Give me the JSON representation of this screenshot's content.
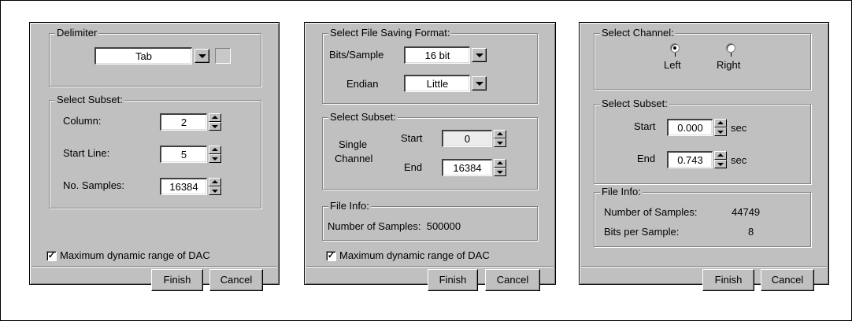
{
  "panel1": {
    "delimiter_title": "Delimiter",
    "delimiter_value": "Tab",
    "subset_title": "Select Subset:",
    "column_label": "Column:",
    "column_value": "2",
    "start_line_label": "Start Line:",
    "start_line_value": "5",
    "samples_label": "No. Samples:",
    "samples_value": "16384",
    "max_dac_label": "Maximum dynamic range of DAC",
    "max_dac_checked": true,
    "finish_label": "Finish",
    "cancel_label": "Cancel"
  },
  "panel2": {
    "format_title": "Select File Saving Format:",
    "bits_label": "Bits/Sample",
    "bits_value": "16 bit",
    "endian_label": "Endian",
    "endian_value": "Little",
    "subset_title": "Select Subset:",
    "single_label": "Single",
    "channel_label": "Channel",
    "start_label": "Start",
    "start_value": "0",
    "end_label": "End",
    "end_value": "16384",
    "fileinfo_title": "File Info:",
    "num_samples_text": "Number of Samples:  500000",
    "max_dac_label": "Maximum dynamic range of DAC",
    "max_dac_checked": true,
    "finish_label": "Finish",
    "cancel_label": "Cancel"
  },
  "panel3": {
    "channel_title": "Select Channel:",
    "left_label": "Left",
    "right_label": "Right",
    "selected_channel": "Left",
    "subset_title": "Select Subset:",
    "start_label": "Start",
    "start_value": "0.000",
    "start_unit": "sec",
    "end_label": "End",
    "end_value": "0.743",
    "end_unit": "sec",
    "fileinfo_title": "File Info:",
    "num_samples_label": "Number of Samples:",
    "num_samples_value": "44749",
    "bits_per_sample_label": "Bits per Sample:",
    "bits_per_sample_value": "8",
    "finish_label": "Finish",
    "cancel_label": "Cancel"
  }
}
